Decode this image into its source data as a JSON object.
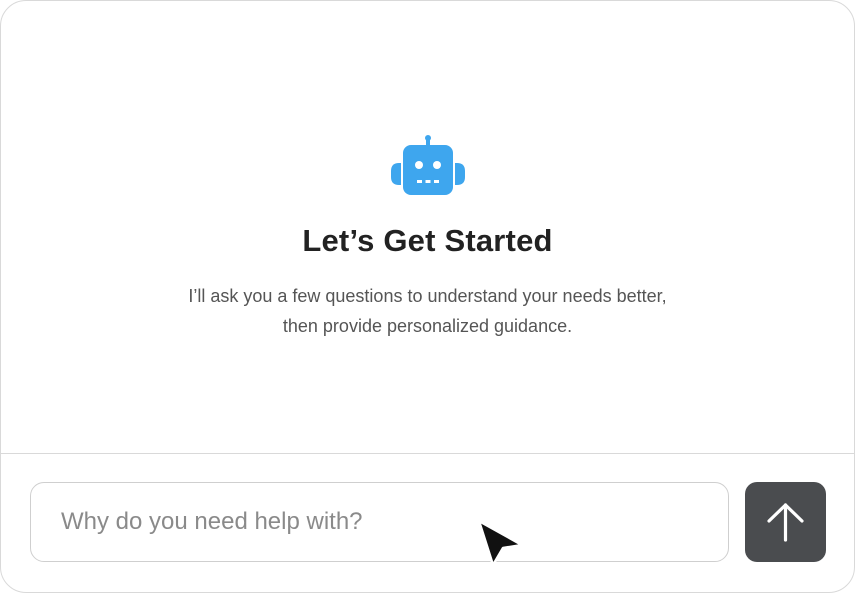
{
  "hero": {
    "icon": "robot-icon",
    "title": "Let’s Get Started",
    "subtitle_line1": "I’ll ask you a few questions to understand your needs better,",
    "subtitle_line2": "then provide personalized guidance."
  },
  "composer": {
    "placeholder": "Why do you need help with?",
    "value": "",
    "send_icon": "arrow-up-icon"
  },
  "colors": {
    "accent": "#3ea6ee",
    "send_button": "#4a4c4f",
    "title": "#222222",
    "body_text": "#555555",
    "border": "#d9d9d9"
  }
}
